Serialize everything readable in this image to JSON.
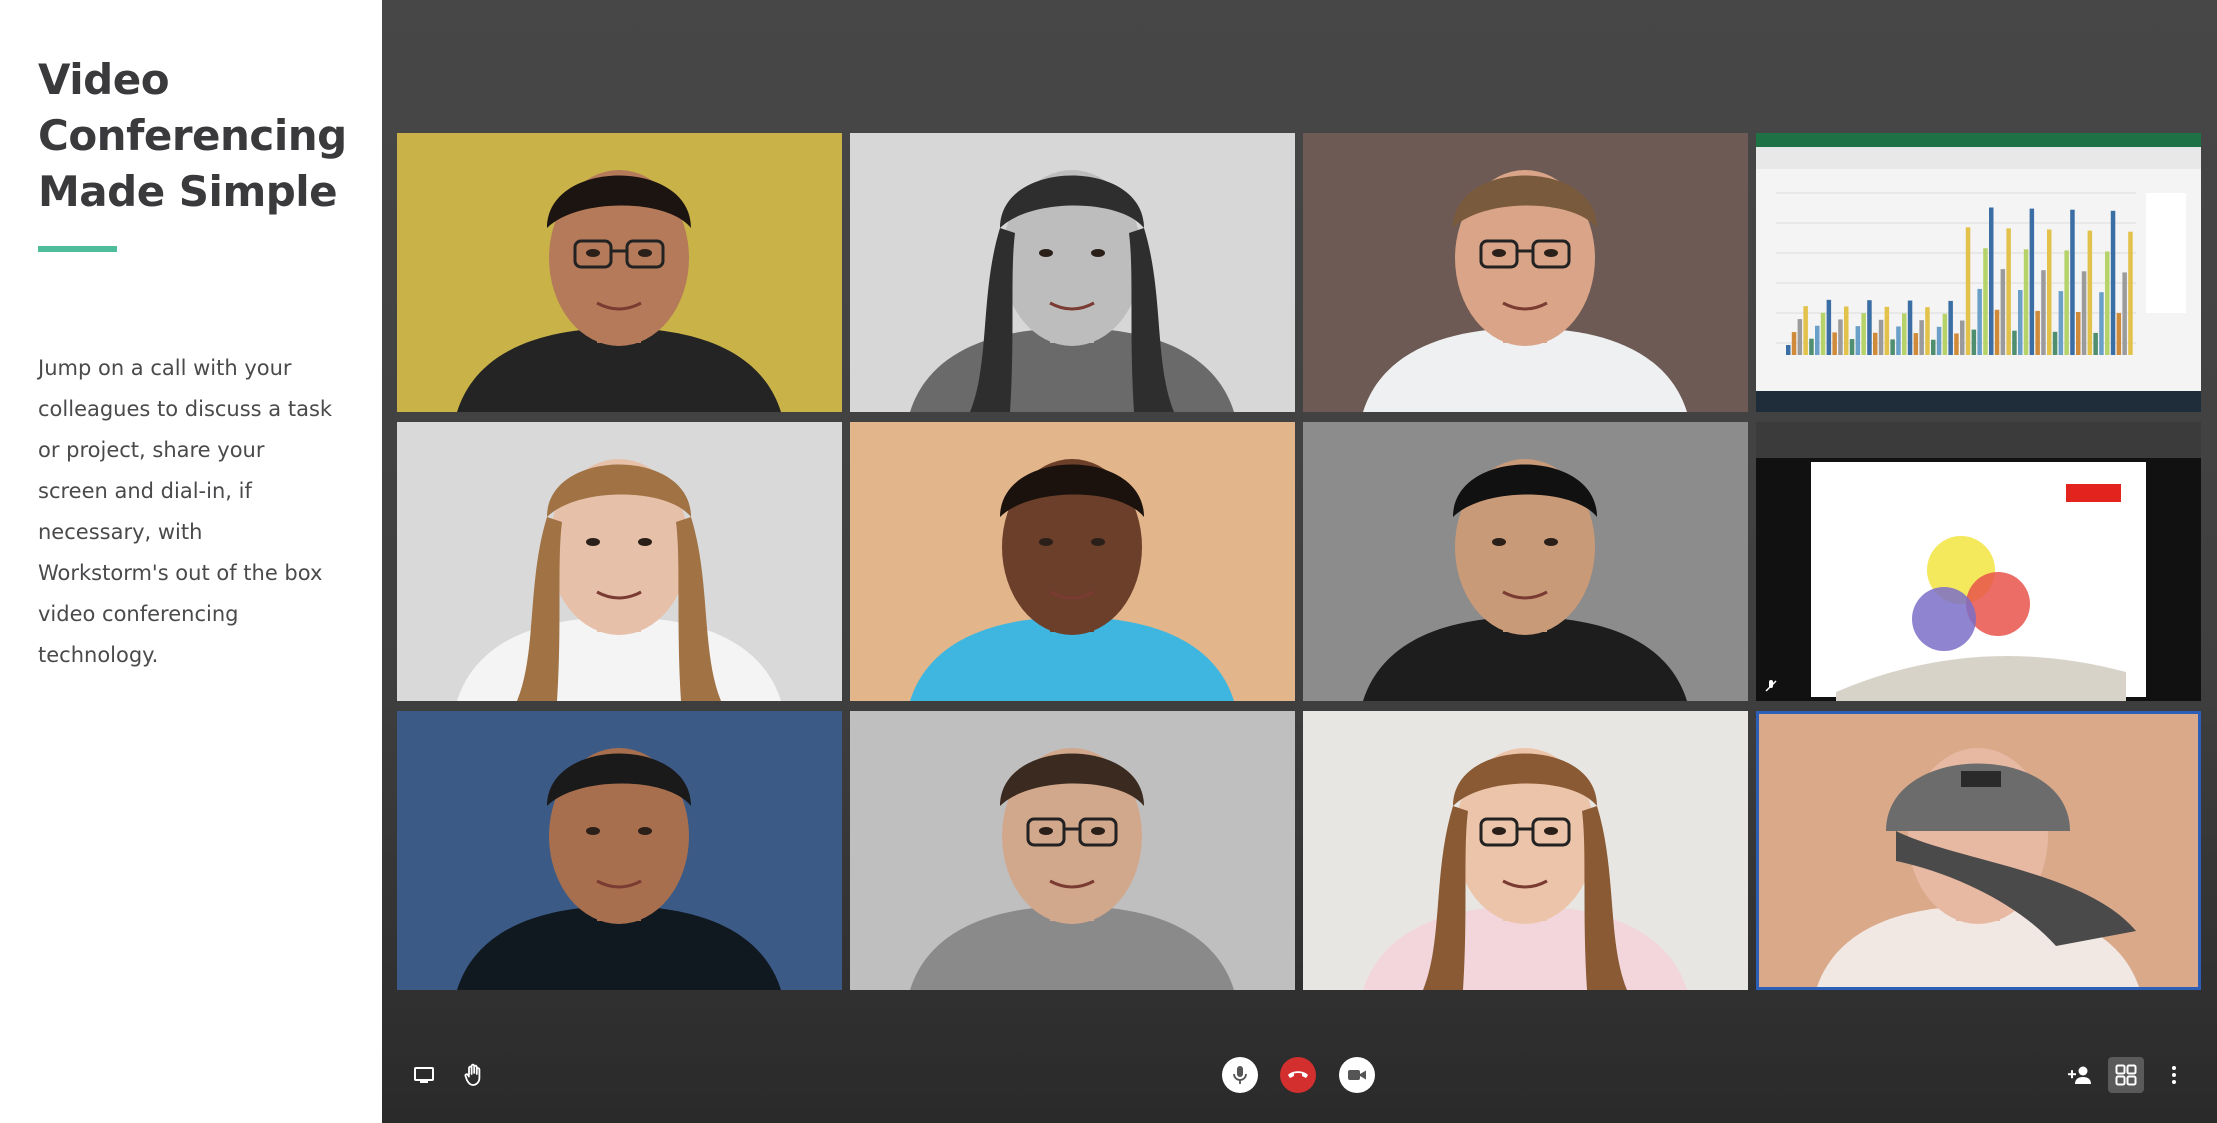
{
  "sidebar": {
    "title_lines": [
      "Video",
      "Conferencing",
      "Made Simple"
    ],
    "description_lines": [
      "Jump on a call with your",
      "colleagues to discuss a task",
      "or project, share your",
      "screen and dial-in, if",
      "necessary, with",
      "Workstorm's out of the box",
      "video conferencing",
      "technology."
    ]
  },
  "colors": {
    "accent": "#4dbd9c",
    "stage_bg": "#444444",
    "end_call": "#d32f2f",
    "active_tile_border": "#2e5fb8"
  },
  "participants": [
    {
      "kind": "portrait",
      "skin": "#b57a5a",
      "hair": "#1c1410",
      "bg": "#c9b348",
      "shirt": "#242424",
      "glasses": true
    },
    {
      "kind": "portrait",
      "skin": "#bdbdbd",
      "hair": "#2e2e2e",
      "bg": "#d7d7d7",
      "shirt": "#6a6a6a",
      "glasses": false
    },
    {
      "kind": "portrait",
      "skin": "#d9a487",
      "hair": "#7a5a3c",
      "bg": "#6e5a55",
      "shirt": "#eef0f2",
      "glasses": true
    },
    {
      "kind": "screen-share-spreadsheet",
      "muted": false
    },
    {
      "kind": "portrait",
      "skin": "#e6c0a8",
      "hair": "#a07244",
      "bg": "#d9d9d9",
      "shirt": "#f4f4f4",
      "glasses": false
    },
    {
      "kind": "portrait",
      "skin": "#6b3f2a",
      "hair": "#1b120d",
      "bg": "#e2b58a",
      "shirt": "#3fb6e0",
      "glasses": false
    },
    {
      "kind": "portrait",
      "skin": "#c99a78",
      "hair": "#111111",
      "bg": "#8c8c8c",
      "shirt": "#1d1d1d",
      "glasses": false
    },
    {
      "kind": "screen-share-presentation",
      "muted": true
    },
    {
      "kind": "portrait",
      "skin": "#a86f4e",
      "hair": "#1a1a1a",
      "bg": "#3b5a86",
      "shirt": "#101820",
      "glasses": false
    },
    {
      "kind": "portrait",
      "skin": "#d2a88c",
      "hair": "#3a2a20",
      "bg": "#bfbfbf",
      "shirt": "#8a8a8a",
      "glasses": true
    },
    {
      "kind": "portrait",
      "skin": "#ecc4aa",
      "hair": "#8a5a34",
      "bg": "#e8e6e2",
      "shirt": "#f2d6dc",
      "glasses": true
    },
    {
      "kind": "portrait-cap",
      "skin": "#e7b9a2",
      "hair": "#6c6c6c",
      "bg": "#d9a98a",
      "shirt": "#f1e7e3",
      "glasses": false,
      "active": true
    }
  ],
  "controls": {
    "left": [
      "screen-share-icon",
      "raise-hand-icon"
    ],
    "center": [
      "microphone-icon",
      "end-call-icon",
      "camera-icon"
    ],
    "right": [
      "add-participant-icon",
      "grid-view-icon",
      "more-options-icon"
    ]
  }
}
